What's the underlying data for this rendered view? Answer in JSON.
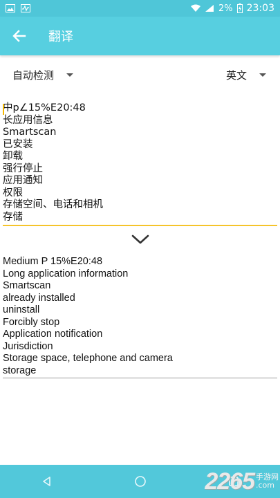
{
  "status_bar": {
    "battery": "2%",
    "time": "23:03",
    "icons": [
      "image-icon",
      "activity-icon",
      "wifi-icon",
      "signal-icon",
      "battery-charging-icon"
    ]
  },
  "app_bar": {
    "title": "翻译",
    "back_icon": "arrow-left-icon"
  },
  "languages": {
    "source": "自动检测",
    "target": "英文"
  },
  "source_text": [
    "中p∠15%E20:48",
    "长应用信息",
    "Smartscan",
    "已安装",
    "卸载",
    "强行停止",
    "应用通知",
    "权限",
    "存储空间、电话和相机",
    "存储"
  ],
  "swap_icon": "chevron-down-icon",
  "result_text": [
    "Medium P 15%E20:48",
    "Long application information",
    "Smartscan",
    "already installed",
    "uninstall",
    "Forcibly stop",
    "Application notification",
    "Jurisdiction",
    "Storage space, telephone and camera",
    "storage"
  ],
  "nav_bar": {
    "buttons": [
      "back-triangle-icon",
      "home-circle-icon",
      "recents-square-icon"
    ]
  },
  "watermark": {
    "number": "2265",
    "site_cn": "手游网",
    "site_en": ".com"
  },
  "colors": {
    "app_bar": "#57cfe0",
    "status_bar": "#4fc6d8",
    "nav_bar": "#52c8da",
    "accent_underline": "#f5c42b"
  }
}
